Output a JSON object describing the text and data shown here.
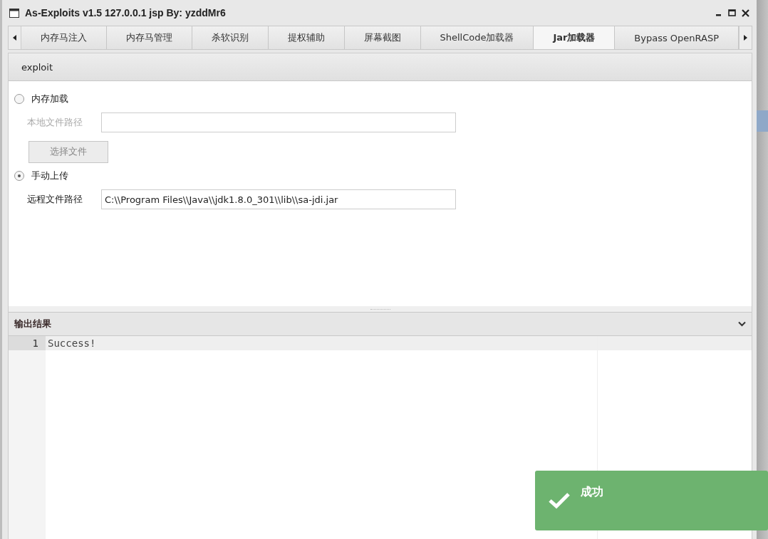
{
  "window": {
    "title": "As-Exploits v1.5 127.0.0.1 jsp By: yzddMr6"
  },
  "tabs": [
    {
      "label": "内存马注入",
      "selected": false
    },
    {
      "label": "内存马管理",
      "selected": false
    },
    {
      "label": "杀软识别",
      "selected": false
    },
    {
      "label": "提权辅助",
      "selected": false
    },
    {
      "label": "屏幕截图",
      "selected": false
    },
    {
      "label": "ShellCode加载器",
      "selected": false
    },
    {
      "label": "Jar加载器",
      "selected": true
    },
    {
      "label": "Bypass OpenRASP",
      "selected": false
    }
  ],
  "toolbar": {
    "button": "exploit"
  },
  "options": [
    {
      "label": "内存加载",
      "selected": false,
      "field_label": "本地文件路径",
      "button": "选择文件"
    },
    {
      "label": "手动上传",
      "selected": true,
      "field_label": "远程文件路径",
      "value": "C:\\\\Program Files\\\\Java\\\\jdk1.8.0_301\\\\lib\\\\sa-jdi.jar"
    }
  ],
  "output": {
    "title": "输出结果",
    "lines": [
      {
        "number": "1",
        "text": "Success!"
      }
    ]
  },
  "toast": {
    "title": "成功"
  }
}
